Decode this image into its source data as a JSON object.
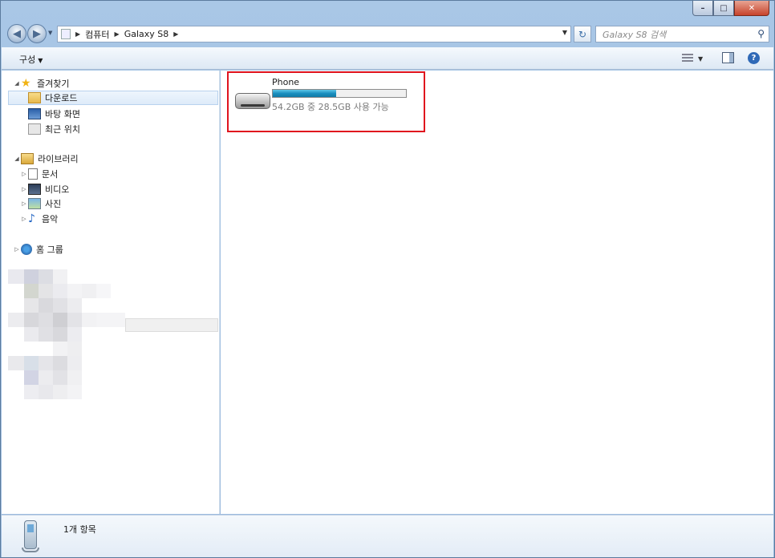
{
  "window": {
    "min_label": "–",
    "max_label": "□",
    "close_label": "✕"
  },
  "address": {
    "back_label": "◀",
    "forward_label": "▶",
    "crumbs": [
      "컴퓨터",
      "Galaxy S8"
    ],
    "refresh_label": "↻",
    "search_placeholder": "Galaxy S8 검색"
  },
  "toolbar": {
    "organize_label": "구성"
  },
  "navpane": {
    "favorites": {
      "label": "즐겨찾기",
      "items": [
        "다운로드",
        "바탕 화면",
        "최근 위치"
      ]
    },
    "libraries": {
      "label": "라이브러리",
      "items": [
        "문서",
        "비디오",
        "사진",
        "음악"
      ]
    },
    "homegroup": {
      "label": "홈 그룹"
    }
  },
  "content": {
    "drive": {
      "name": "Phone",
      "space_text": "54.2GB 중 28.5GB 사용 가능",
      "used_fraction": 0.474
    }
  },
  "details": {
    "item_count": "1개 항목"
  },
  "colors": {
    "highlight_border": "#e0141e",
    "progress_fill": "#1a8fbf",
    "selection_bg": "#deebf9"
  }
}
